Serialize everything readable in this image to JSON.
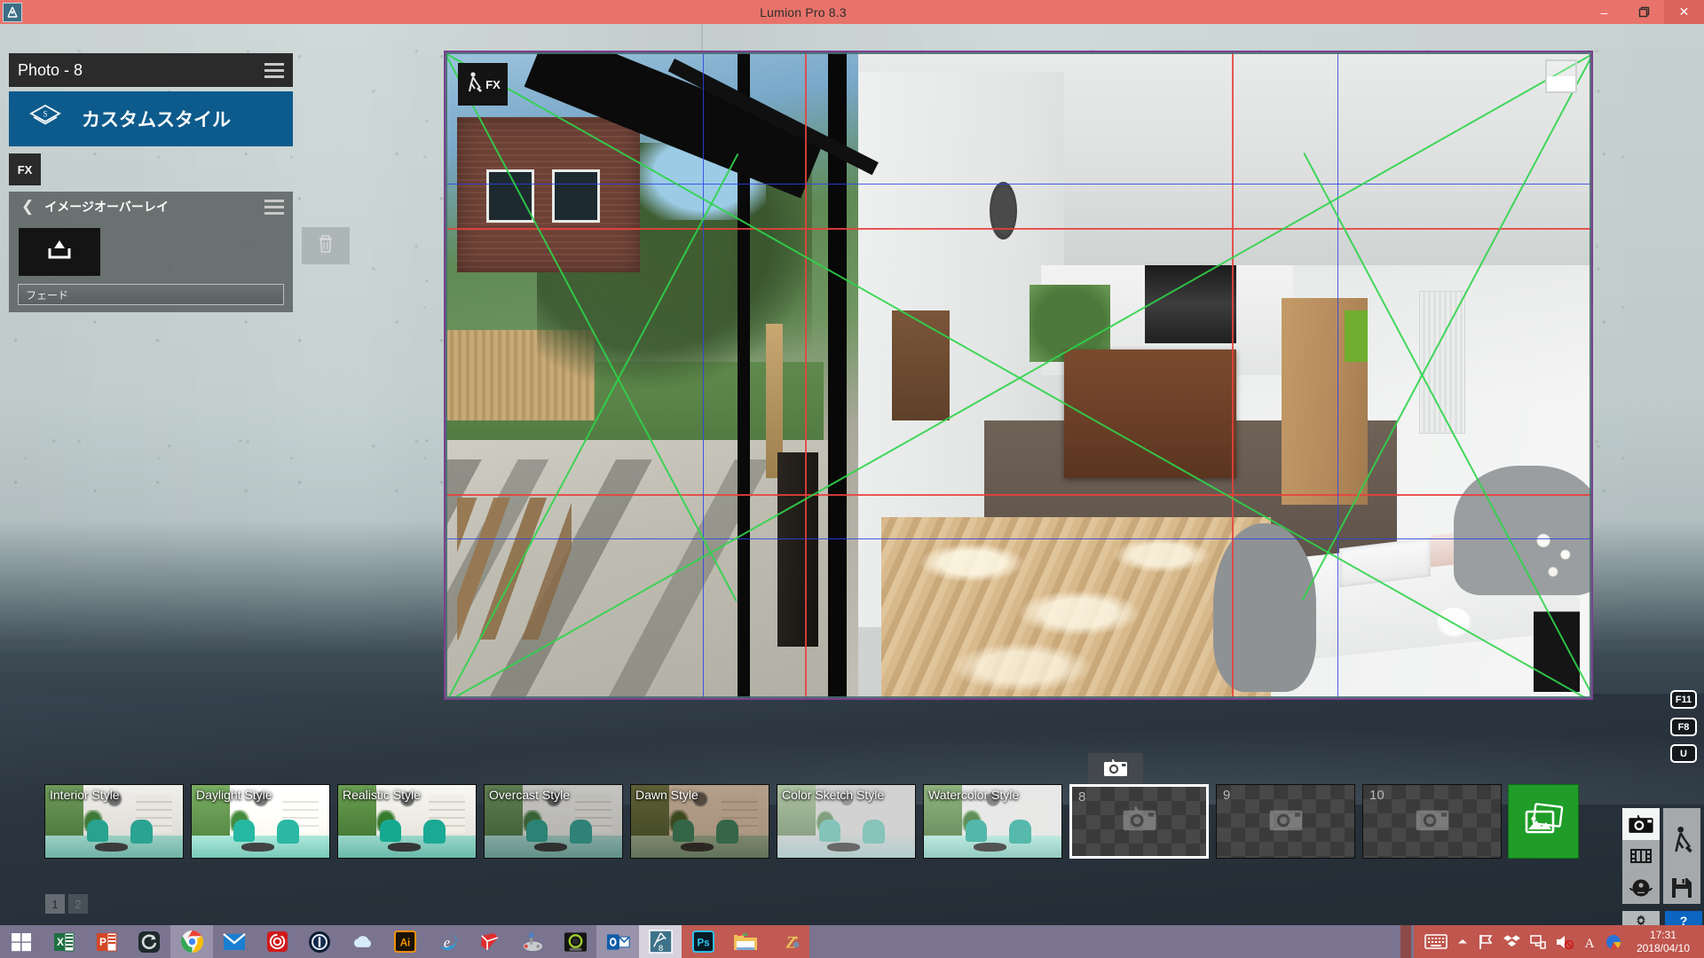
{
  "window": {
    "title": "Lumion Pro 8.3",
    "app_icon": "lumion-icon",
    "minimize_label": "–",
    "restore_label": "❐",
    "close_label": "✕"
  },
  "left_panel": {
    "photo_header_title": "Photo - 8",
    "photo_menu_icon": "hamburger-icon",
    "style_button": {
      "label": "カスタムスタイル",
      "icon": "style-layers-icon",
      "color": "#0d5b8c"
    },
    "fx_chip_label": "FX",
    "overlay_effect": {
      "back_icon": "chevron-left-icon",
      "title": "イメージオーバーレイ",
      "menu_icon": "hamburger-icon",
      "delete_icon": "trash-icon",
      "upload_icon": "upload-tray-icon",
      "slider_label": "フェード"
    }
  },
  "viewport": {
    "fx_badge": {
      "icon": "worker-shovel-icon",
      "label": "FX"
    },
    "overlay_thumbnail_name": "image-overlay-thumbnail",
    "guides": {
      "thirds_color": "#e8413c",
      "golden_color": "#2f42e8",
      "diagonal_color": "#2fd44a",
      "border_color": "#7b3f8e"
    }
  },
  "hotkeys": [
    {
      "label": "F11"
    },
    {
      "label": "F8"
    },
    {
      "label": "U"
    }
  ],
  "thumbnails": [
    {
      "label": "Interior Style",
      "empty": false,
      "selected": false
    },
    {
      "label": "Daylight Style",
      "empty": false,
      "selected": false
    },
    {
      "label": "Realistic Style",
      "empty": false,
      "selected": false
    },
    {
      "label": "Overcast Style",
      "empty": false,
      "selected": false
    },
    {
      "label": "Dawn Style",
      "empty": false,
      "selected": false
    },
    {
      "label": "Color Sketch Style",
      "empty": false,
      "selected": false
    },
    {
      "label": "Watercolor Style",
      "empty": false,
      "selected": false
    },
    {
      "label": "8",
      "empty": true,
      "selected": true
    },
    {
      "label": "9",
      "empty": true,
      "selected": false
    },
    {
      "label": "10",
      "empty": true,
      "selected": false
    }
  ],
  "capture_button_icon": "camera-icon",
  "render_button": {
    "icon": "photos-stack-icon",
    "color": "#1f9d28"
  },
  "page_tabs": [
    {
      "label": "1",
      "active": true
    },
    {
      "label": "2",
      "active": false
    }
  ],
  "mode_buttons": {
    "photo": {
      "icon": "camera-icon",
      "active": true
    },
    "movie": {
      "icon": "film-strip-icon",
      "active": false
    },
    "panorama": {
      "icon": "person-360-icon",
      "active": false
    },
    "build": {
      "icon": "worker-shovel-icon",
      "active": false
    },
    "save": {
      "icon": "floppy-disk-icon",
      "active": false
    },
    "settings": {
      "icon": "gear-icon",
      "label": ""
    },
    "help": {
      "icon": "question-icon",
      "label": "?"
    }
  },
  "taskbar": {
    "start_icon": "windows-logo-icon",
    "items": [
      {
        "name": "excel",
        "label": "X",
        "state": "pinned"
      },
      {
        "name": "powerpoint",
        "label": "P",
        "state": "pinned"
      },
      {
        "name": "glary-utilities",
        "label": "G",
        "state": "pinned"
      },
      {
        "name": "google-chrome",
        "label": "",
        "state": "active-light"
      },
      {
        "name": "mail",
        "label": "",
        "state": "pinned"
      },
      {
        "name": "adobe-creative-cloud",
        "label": "",
        "state": "pinned"
      },
      {
        "name": "1password",
        "label": "",
        "state": "pinned"
      },
      {
        "name": "onedrive",
        "label": "",
        "state": "pinned"
      },
      {
        "name": "adobe-illustrator",
        "label": "Ai",
        "state": "pinned"
      },
      {
        "name": "internet-explorer",
        "label": "e",
        "state": "pinned"
      },
      {
        "name": "sketchup",
        "label": "",
        "state": "pinned"
      },
      {
        "name": "game-controller",
        "label": "",
        "state": "pinned"
      },
      {
        "name": "wacom-tablet",
        "label": "",
        "state": "pinned"
      },
      {
        "name": "microsoft-outlook",
        "label": "O",
        "state": "active-light"
      },
      {
        "name": "lumion-8",
        "label": "8",
        "state": "active-white"
      },
      {
        "name": "adobe-photoshop",
        "label": "Ps",
        "state": "open-red"
      },
      {
        "name": "file-explorer",
        "label": "",
        "state": "open-red"
      },
      {
        "name": "zbrush",
        "label": "Z",
        "state": "open-red"
      }
    ],
    "tray": {
      "keyboard_icon": "keyboard-icon",
      "overflow_icon": "chevron-up-icon",
      "flag_icon": "flag-icon",
      "dropbox_icon": "dropbox-icon",
      "network_icon": "network-icon",
      "volume_icon": "volume-muted-icon",
      "ime_icon": "ime-a-icon",
      "google_icon": "google-icon",
      "time": "17:31",
      "date": "2018/04/10"
    }
  }
}
